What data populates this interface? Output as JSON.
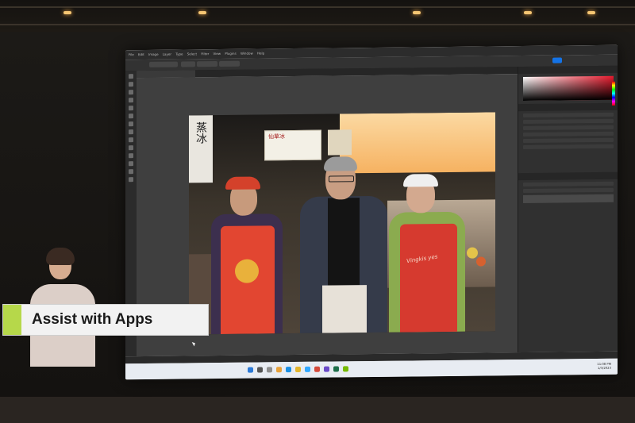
{
  "stage": {
    "banner_text": "Assist with Apps",
    "banner_accent_color": "#b6d84a"
  },
  "app": {
    "name": "Photoshop",
    "menu": [
      "File",
      "Edit",
      "Image",
      "Layer",
      "Type",
      "Select",
      "Filter",
      "View",
      "Plugins",
      "Window",
      "Help"
    ],
    "accent_color": "#1473e6"
  },
  "photo": {
    "sign_chars": "蒸冰",
    "menu_sign": "仙草冰",
    "apron_text": "Vingkis yes"
  },
  "taskbar": {
    "time": "11:08 PM",
    "date": "1/3/2023"
  }
}
